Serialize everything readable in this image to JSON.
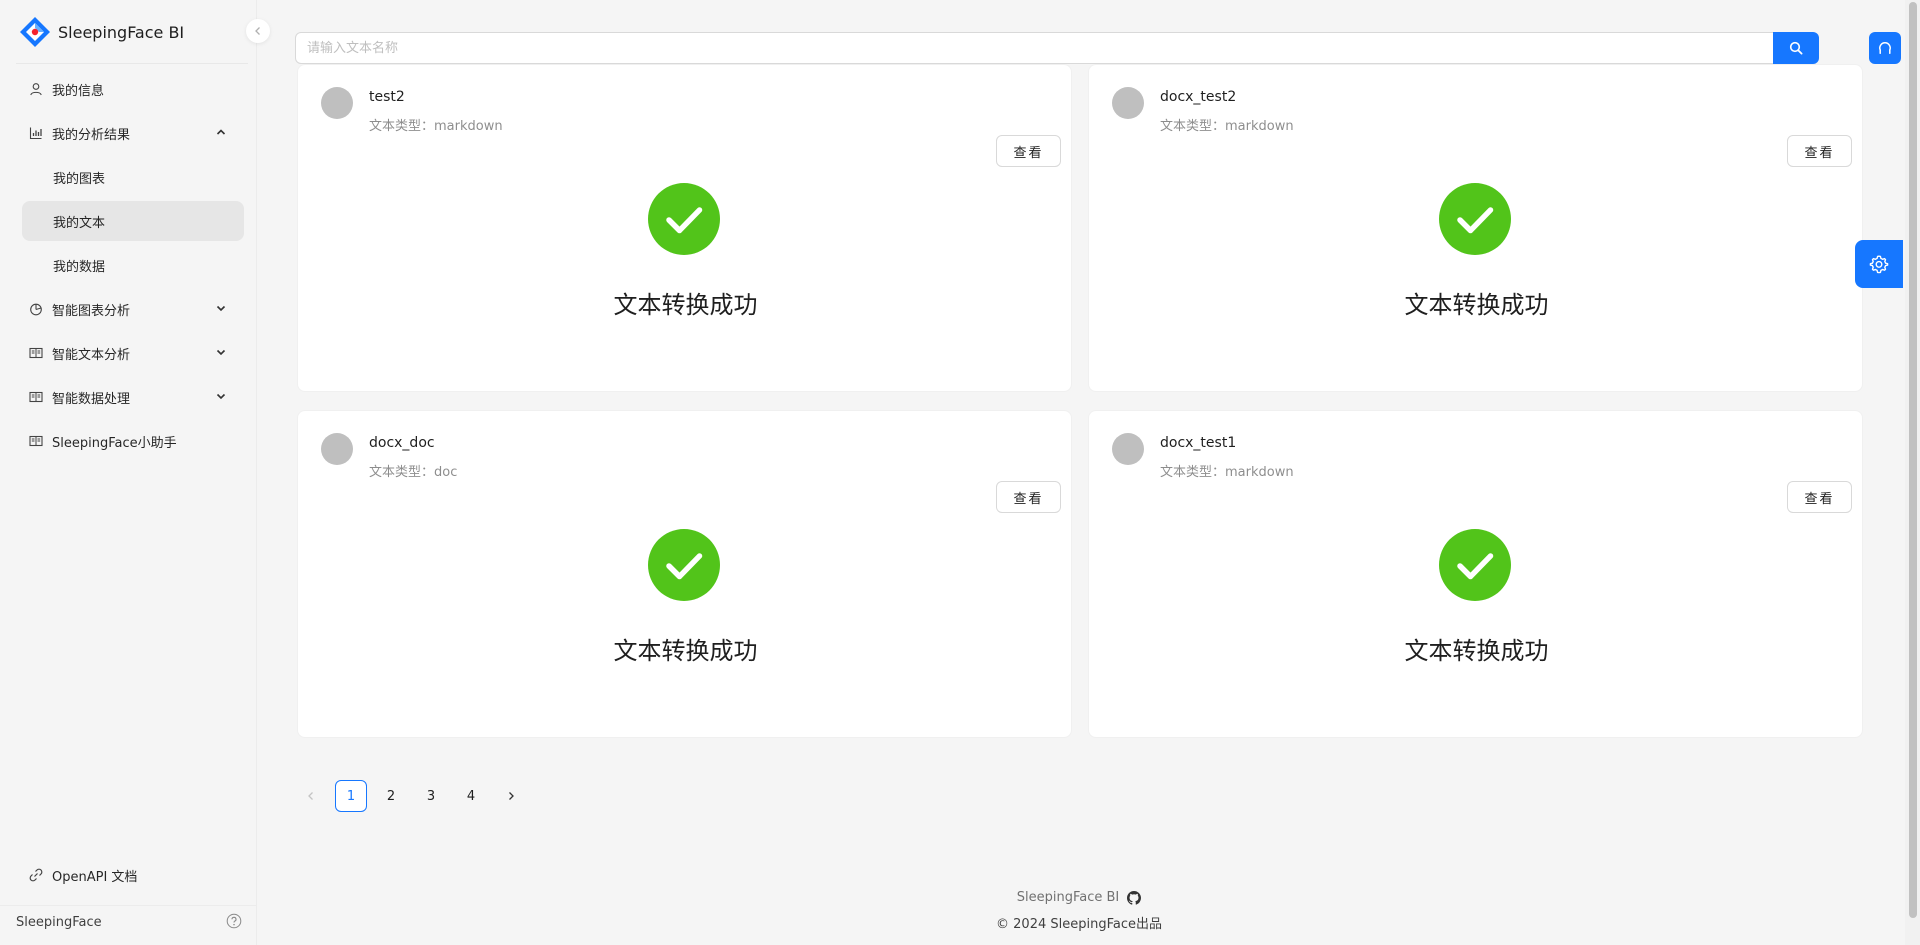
{
  "brand": {
    "name": "SleepingFace BI"
  },
  "sidebar": {
    "items": [
      {
        "label": "我的信息",
        "icon": "user-icon"
      },
      {
        "label": "我的分析结果",
        "icon": "bar-chart-icon",
        "expanded": true,
        "children": [
          {
            "label": "我的图表"
          },
          {
            "label": "我的文本",
            "selected": true
          },
          {
            "label": "我的数据"
          }
        ]
      },
      {
        "label": "智能图表分析",
        "icon": "pie-chart-icon"
      },
      {
        "label": "智能文本分析",
        "icon": "book-icon"
      },
      {
        "label": "智能数据处理",
        "icon": "book-icon"
      },
      {
        "label": "SleepingFace小助手",
        "icon": "book-icon"
      }
    ],
    "openapi_label": "OpenAPI 文档",
    "user_name": "SleepingFace"
  },
  "search": {
    "placeholder": "请输入文本名称"
  },
  "cards": [
    {
      "title": "test2",
      "desc": "文本类型：markdown",
      "button": "查看",
      "result": "文本转换成功"
    },
    {
      "title": "docx_test2",
      "desc": "文本类型：markdown",
      "button": "查看",
      "result": "文本转换成功"
    },
    {
      "title": "docx_doc",
      "desc": "文本类型：doc",
      "button": "查看",
      "result": "文本转换成功"
    },
    {
      "title": "docx_test1",
      "desc": "文本类型：markdown",
      "button": "查看",
      "result": "文本转换成功"
    }
  ],
  "pagination": {
    "pages": [
      "1",
      "2",
      "3",
      "4"
    ],
    "current": "1"
  },
  "footer": {
    "brand": "SleepingFace BI",
    "copyright": "2024 SleepingFace出品"
  },
  "colors": {
    "primary": "#1677ff",
    "success": "#52c41a",
    "avatar": "#bfbfbf"
  }
}
